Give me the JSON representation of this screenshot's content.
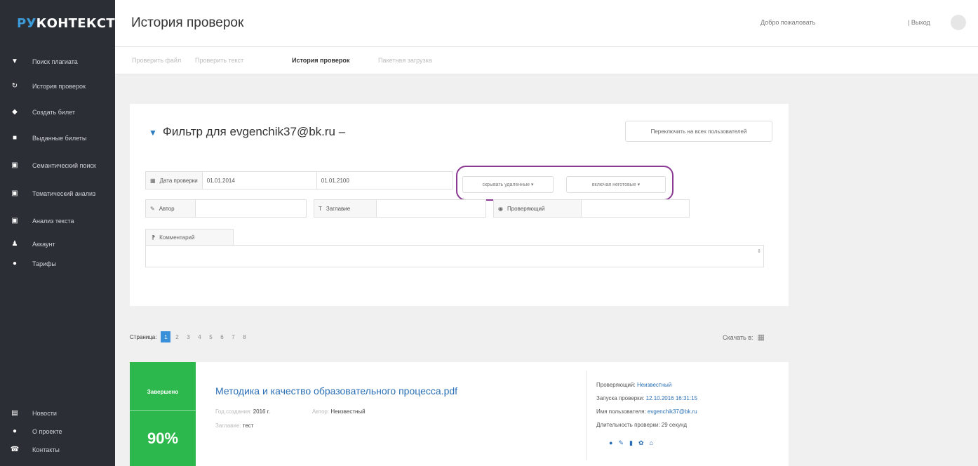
{
  "logo": {
    "part1": "РУ",
    "part2": "КОНТЕКСТ"
  },
  "sidebar": {
    "items": [
      {
        "icon": "▼",
        "label": "Поиск плагиата"
      },
      {
        "icon": "↻",
        "label": "История проверок"
      },
      {
        "icon": "◆",
        "label": "Создать билет"
      },
      {
        "icon": "■",
        "label": "Выданные билеты"
      },
      {
        "icon": "▣",
        "label": "Семантический поиск"
      },
      {
        "icon": "▣",
        "label": "Тематический анализ"
      },
      {
        "icon": "▣",
        "label": "Анализ текста"
      },
      {
        "icon": "♟",
        "label": "Аккаунт"
      },
      {
        "icon": "●",
        "label": "Тарифы"
      }
    ],
    "bottom_items": [
      {
        "icon": "▤",
        "label": "Новости"
      },
      {
        "icon": "●",
        "label": "О проекте"
      },
      {
        "icon": "☎",
        "label": "Контакты"
      }
    ]
  },
  "header": {
    "title": "История проверок",
    "welcome": "Добро пожаловать",
    "logout": "| Выход"
  },
  "tabs": [
    {
      "label": "Проверить файл",
      "active": false
    },
    {
      "label": "Проверить текст",
      "active": false
    },
    {
      "label": "История проверок",
      "active": true
    },
    {
      "label": "Пакетная загрузка",
      "active": false
    }
  ],
  "filter": {
    "title": "Фильтр для evgenchik37@bk.ru  –",
    "switch_button": "Переключить на всех пользователей",
    "date_label": "Дата проверки",
    "date_from": "01.01.2014",
    "date_to": "01.01.2100",
    "dropdown1": "скрывать удаленные ▾",
    "dropdown2": "включая неготовые ▾",
    "author_label": "Автор",
    "title_label": "Заглавие",
    "checker_label": "Проверяющий",
    "comment_label": "Комментарий"
  },
  "pagination": {
    "label": "Страница:",
    "pages": [
      "1",
      "2",
      "3",
      "4",
      "5",
      "6",
      "7",
      "8"
    ],
    "current": "1"
  },
  "download": {
    "label": "Скачать в:"
  },
  "result": {
    "status": "Завершено",
    "score": "90%",
    "title": "Методика и качество образовательного процесса.pdf",
    "year_label": "Год создания:",
    "year": "2016 г.",
    "author_label": "Автор:",
    "author": "Неизвестный",
    "title_label": "Заглавие:",
    "title_value": "тест",
    "checker_label": "Проверяющий:",
    "checker": "Неизвестный",
    "launch_label": "Запуска проверки:",
    "launch": "12.10.2016 16:31:15",
    "username_label": "Имя пользователя:",
    "username": "evgenchik37@bk.ru",
    "duration_label": "Длительность проверки:",
    "duration": "29 секунд"
  },
  "colors": {
    "sidebar_bg": "#2b2e35",
    "accent_blue": "#3a8fd9",
    "success_green": "#2db84d",
    "highlight_purple": "#8b3a93"
  }
}
